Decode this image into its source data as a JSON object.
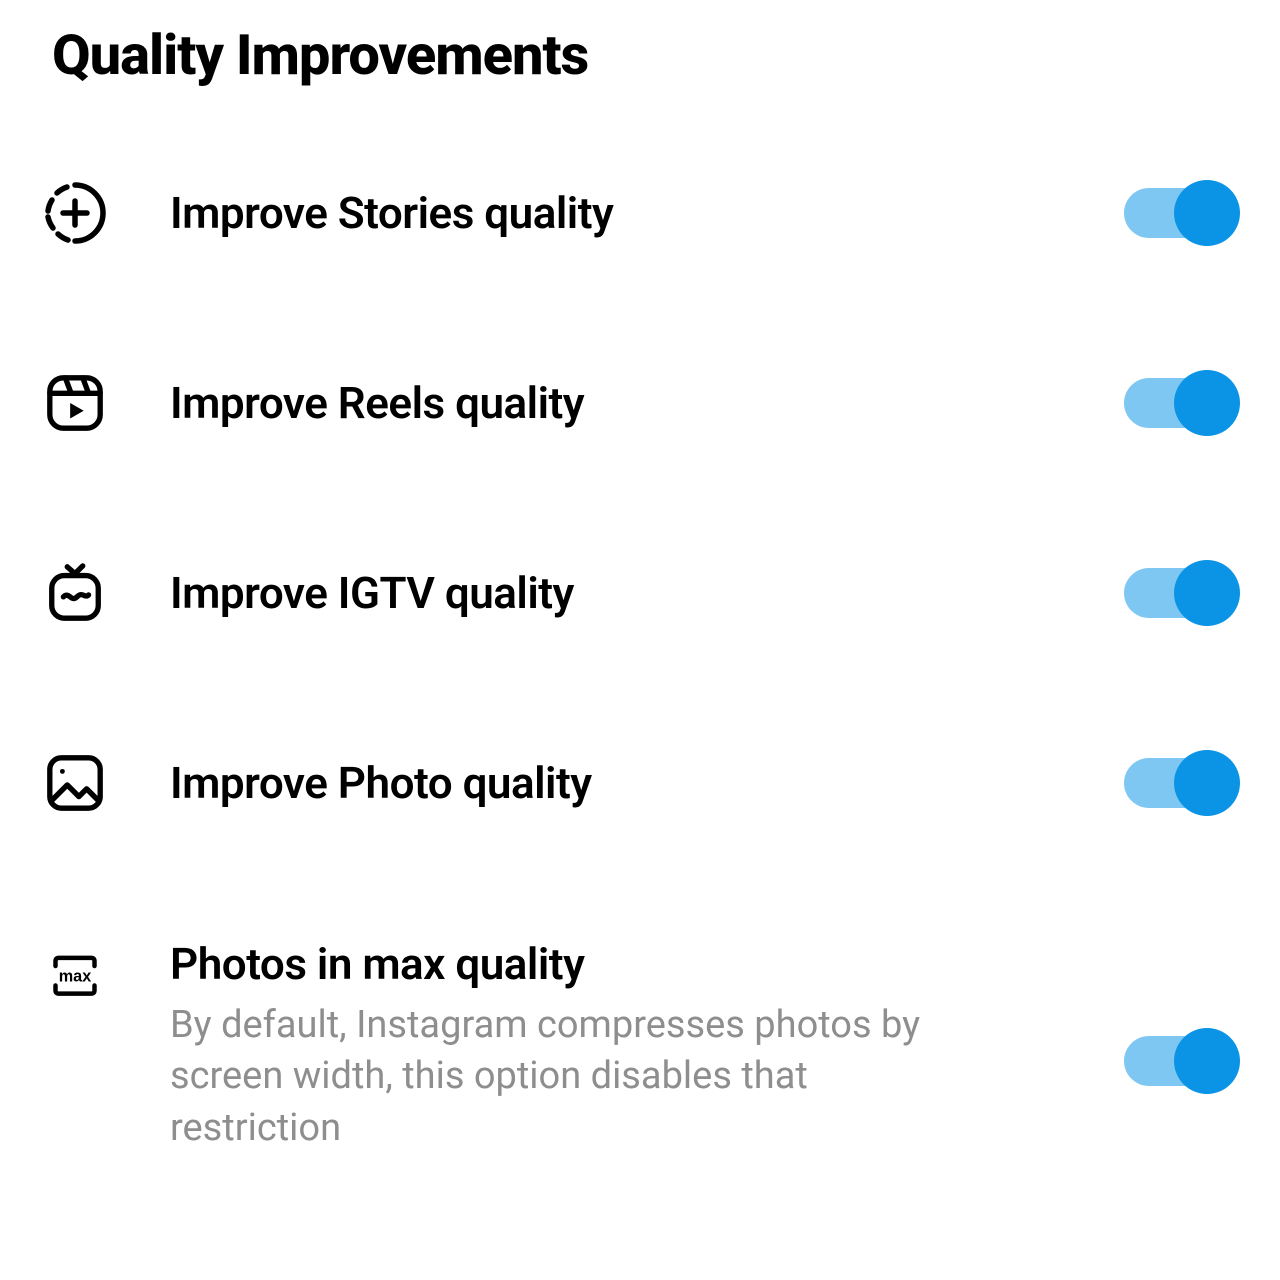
{
  "section": {
    "title": "Quality Improvements"
  },
  "items": [
    {
      "label": "Improve Stories quality",
      "icon": "stories-plus-icon",
      "enabled": true
    },
    {
      "label": "Improve Reels quality",
      "icon": "reels-icon",
      "enabled": true
    },
    {
      "label": "Improve IGTV quality",
      "icon": "igtv-icon",
      "enabled": true
    },
    {
      "label": "Improve Photo quality",
      "icon": "photo-icon",
      "enabled": true
    },
    {
      "label": "Photos in max quality",
      "description": "By default, Instagram compresses photos by screen width, this option disables that restriction",
      "icon": "max-icon",
      "enabled": true
    }
  ],
  "colors": {
    "toggleThumb": "#0b94e5",
    "toggleTrack": "#7ec7f2",
    "descriptionText": "#8e8e8e"
  }
}
